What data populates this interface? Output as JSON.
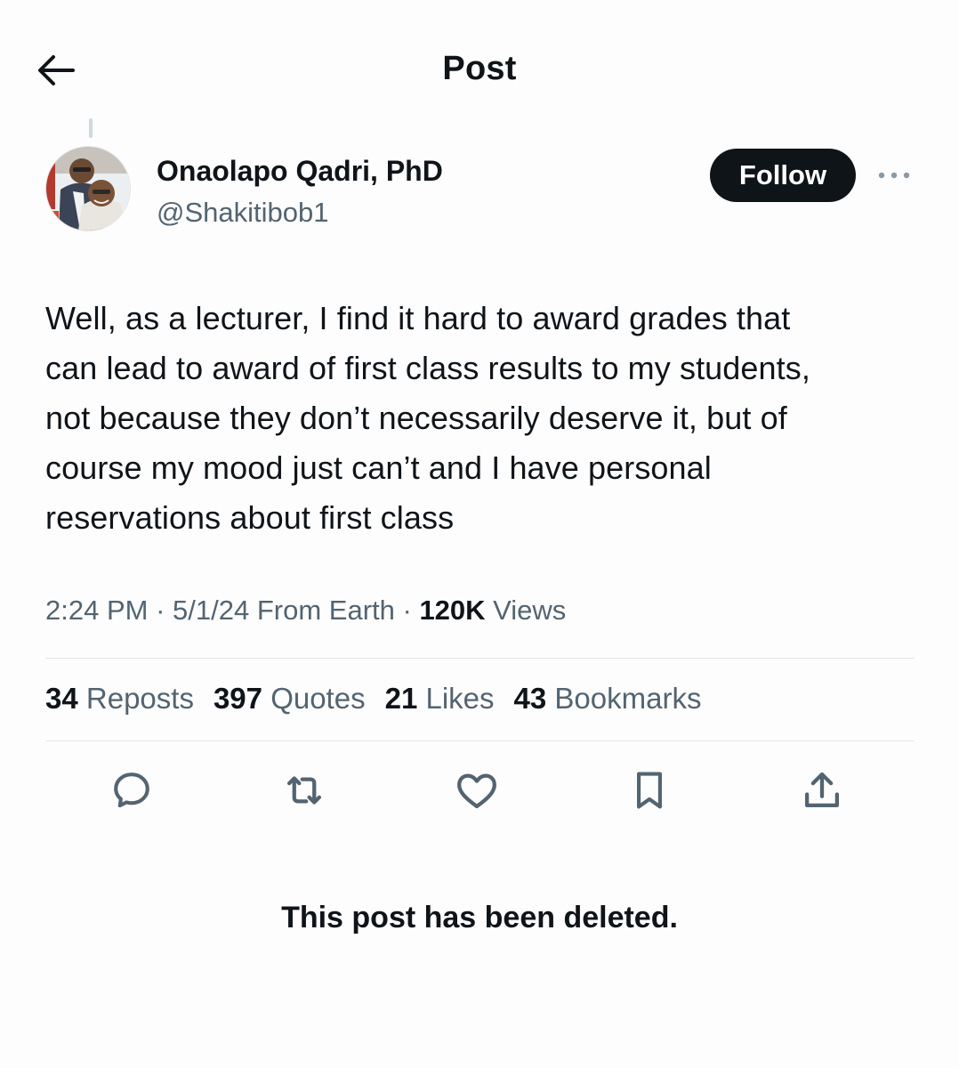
{
  "header": {
    "back_icon": "arrow-left-icon",
    "title": "Post"
  },
  "author": {
    "display_name": "Onaolapo Qadri, PhD",
    "handle": "@Shakitibob1",
    "follow_label": "Follow",
    "more_icon": "more-horizontal-icon"
  },
  "post": {
    "text": "Well, as a lecturer, I find it hard to award grades that\ncan lead to award of first class results to my students,\nnot because they don’t necessarily deserve it, but of\ncourse my mood just can’t and I have personal\nreservations about first class",
    "time": "2:24 PM",
    "date": "5/1/24",
    "source": "From Earth",
    "views_count": "120K",
    "views_label": "Views"
  },
  "stats": [
    {
      "count": "34",
      "label": "Reposts"
    },
    {
      "count": "397",
      "label": "Quotes"
    },
    {
      "count": "21",
      "label": "Likes"
    },
    {
      "count": "43",
      "label": "Bookmarks"
    }
  ],
  "actions": [
    "reply-icon",
    "repost-icon",
    "like-icon",
    "bookmark-icon",
    "share-icon"
  ],
  "notice": "This post has been deleted.",
  "colors": {
    "text": "#0f1419",
    "secondary": "#536471",
    "follow_bg": "#0f1419",
    "divider": "#e1e6ea"
  }
}
